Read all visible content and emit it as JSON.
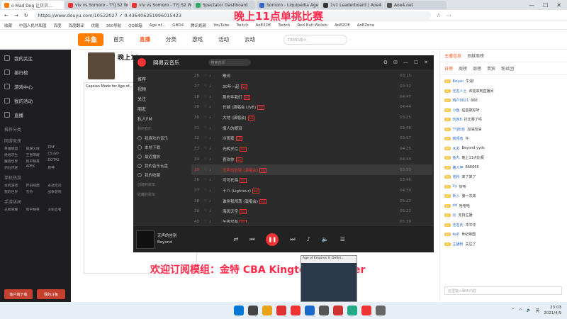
{
  "browser": {
    "tabs": [
      {
        "label": "ó Mad Dog 让贝贝...",
        "color": "#f57c00"
      },
      {
        "label": "viv vs Somoro - TYJ S2 W...",
        "color": "#e33"
      },
      {
        "label": "viv vs Somoro - TYJ S2 W...",
        "color": "#e33"
      },
      {
        "label": "Spectator Dashboard",
        "color": "#3a6"
      },
      {
        "label": "Somoro - Liquipedia Age of",
        "color": "#36c"
      },
      {
        "label": "1v1 Leaderboard | Aoe4",
        "color": "#333"
      },
      {
        "label": "Aoe4.net",
        "color": "#555"
      }
    ],
    "url": "https://www.douyu.com/10522027 ✓ 0.436406251996015423",
    "bookmarks": [
      "收藏",
      "中国人民共和国",
      "百度",
      "百度翻译",
      "优酷",
      "360导航",
      "QQ邮箱",
      "Age of...",
      "GBD4",
      "腾讯视频",
      "YouTube",
      "Twitch",
      "AoE2DE",
      "Twitch",
      "Red Bull Wololo",
      "AoE2DE",
      "AoEZone"
    ]
  },
  "site": {
    "logo": "斗鱼",
    "nav": [
      "首页",
      "直播",
      "分类",
      "游戏",
      "活动",
      "云动"
    ],
    "nav_active": 1,
    "search_placeholder": "TEMD战火"
  },
  "left_menu": {
    "items": [
      "我的关注",
      "排行榜",
      "游戏中心",
      "我的活动",
      "直播"
    ],
    "sections": [
      {
        "title": "推荐分类",
        "items": []
      },
      {
        "title": "网游竞技",
        "items": [
          "英雄联盟",
          "穿越火线",
          "DNF",
          "绝地求生",
          "王者荣耀",
          "CS:GO",
          "魔兽世界",
          "和平精英",
          "DOTA2",
          "炉石传说",
          "APEX",
          "原神"
        ]
      },
      {
        "title": "单机热游",
        "items": [
          "主机游戏",
          "怀旧经典",
          "永劫无间",
          "我的世界",
          "方舟",
          "战争游戏"
        ]
      },
      {
        "title": "手游休闲",
        "items": [
          "王者荣耀",
          "和平精英",
          "火影忍者"
        ]
      }
    ],
    "buttons": [
      "客户端下载",
      "我的斗鱼"
    ]
  },
  "streamer": {
    "name": "晚上11"
  },
  "inner_page_title": "Capsian Mode for Age of...",
  "music": {
    "title": "网易云音乐",
    "search_placeholder": "搜索音乐",
    "sidebar_items": [
      "推荐",
      "视频",
      "关注",
      "朋友",
      "私人FM"
    ],
    "sidebar_section": "我的音乐",
    "playlists": [
      "我喜欢的音乐",
      "本地下载",
      "最近播放",
      "我的音乐云盘",
      "我的收藏"
    ],
    "created_label": "创建的歌单",
    "collected_label": "收藏的歌单",
    "songs": [
      {
        "n": "26",
        "title": "歌词",
        "tag": "",
        "dur": "03:15"
      },
      {
        "n": "27",
        "title": "30年一起",
        "tag": "SQ",
        "dur": "03:32"
      },
      {
        "n": "28",
        "title": "那些年我们",
        "tag": "SQ",
        "dur": "04:47"
      },
      {
        "n": "29",
        "title": "长城 (演唱会 LIVE)",
        "tag": "SQ",
        "dur": "04:44"
      },
      {
        "n": "30",
        "title": "大地 (演唱会)",
        "tag": "SQ",
        "dur": "03:25"
      },
      {
        "n": "31",
        "title": "情人的眼泪",
        "tag": "",
        "dur": "03:46"
      },
      {
        "n": "32",
        "title": "冷雨夜",
        "tag": "SQ",
        "dur": "03:57"
      },
      {
        "n": "33",
        "title": "光辉岁月",
        "tag": "SQ",
        "dur": "04:25"
      },
      {
        "n": "34",
        "title": "喜欢你",
        "tag": "SQ",
        "dur": "04:43"
      },
      {
        "n": "35",
        "title": "无声的告别 (演唱会)",
        "tag": "SQ",
        "dur": "03:53"
      },
      {
        "n": "36",
        "title": "可可托海",
        "tag": "SQ",
        "dur": "03:46"
      },
      {
        "n": "37",
        "title": "十八 (Lightour)",
        "tag": "SQ",
        "dur": "04:39"
      },
      {
        "n": "38",
        "title": "谁伴我闯荡 (演唱会)",
        "tag": "SQ",
        "dur": "05:22"
      },
      {
        "n": "39",
        "title": "海阔天空",
        "tag": "SQ",
        "dur": "05:22"
      },
      {
        "n": "40",
        "title": "午夜怨曲",
        "tag": "SQ",
        "dur": "05:39"
      },
      {
        "n": "41",
        "title": "真的爱你 (演唱会)",
        "tag": "SQ",
        "dur": "04:54"
      }
    ],
    "current_index": 9,
    "now_playing": {
      "title": "无声的告别",
      "artist": "Beyond"
    }
  },
  "right_panel": {
    "tabs": [
      "主播信息",
      "贡献周榜"
    ],
    "tabs2": [
      "日榜",
      "周榜",
      "周榜",
      "贵宾",
      "粉丝团"
    ],
    "chat": [
      {
        "user": "Boyan",
        "text": "牛逼！"
      },
      {
        "user": "无名人士",
        "text": "欢迎来到直播间"
      },
      {
        "user": "用户9021",
        "text": "666"
      },
      {
        "user": "小鱼",
        "text": "这首歌好听"
      },
      {
        "user": "玩家8",
        "text": "打比赛了吗"
      },
      {
        "user": "TYJ粉丝",
        "text": "加油加油"
      },
      {
        "user": "旁观者",
        "text": "牛"
      },
      {
        "user": "水友",
        "text": "Beyond yyds"
      },
      {
        "user": "鱼丸",
        "text": "晚上11点比赛"
      },
      {
        "user": "路人甲",
        "text": "666666"
      },
      {
        "user": "老粉",
        "text": "来了来了"
      },
      {
        "user": "Xy",
        "text": "好听"
      },
      {
        "user": "新人",
        "text": "第一次来"
      },
      {
        "user": "dd",
        "text": "哈哈哈"
      },
      {
        "user": "云",
        "text": "支持主播"
      },
      {
        "user": "无名氏",
        "text": "冲冲冲"
      },
      {
        "user": "AoE",
        "text": "世纪帝国"
      },
      {
        "user": "主播粉",
        "text": "关注了"
      }
    ],
    "chat_placeholder": "这里输入聊天内容"
  },
  "overlay": {
    "top": "晚上11点单挑比赛",
    "bottom": "欢迎订阅模组：金特 CBA Kingte Carpenter"
  },
  "thumbnail_caption": "Age of Empires II: Defini...",
  "taskbar": {
    "lang": "英",
    "time": "23:03",
    "date": "2021/4/9"
  }
}
